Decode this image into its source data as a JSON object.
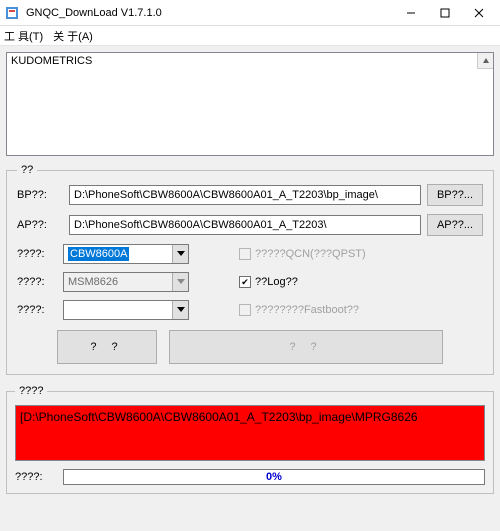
{
  "window": {
    "title": "GNQC_DownLoad V1.7.1.0"
  },
  "menu": {
    "tools": "工 具(T)",
    "about": "关 于(A)"
  },
  "log": {
    "text": "KUDOMETRICS"
  },
  "paths_group": {
    "legend": "??",
    "bp_label": "BP??:",
    "bp_value": "D:\\PhoneSoft\\CBW8600A\\CBW8600A01_A_T2203\\bp_image\\",
    "bp_btn": "BP??...",
    "ap_label": "AP??:",
    "ap_value": "D:\\PhoneSoft\\CBW8600A\\CBW8600A01_A_T2203\\",
    "ap_btn": "AP??..."
  },
  "config": {
    "row1_label": "????:",
    "row1_value": "CBW8600A",
    "row1_check": "?????QCN(???QPST)",
    "row2_label": "????:",
    "row2_value": "MSM8626",
    "row2_check": "??Log??",
    "row3_label": "????:",
    "row3_value": "",
    "row3_check": "????????Fastboot??"
  },
  "buttons": {
    "left": "?   ?",
    "right": "?      ?"
  },
  "status": {
    "legend": "????",
    "text": "[D:\\PhoneSoft\\CBW8600A\\CBW8600A01_A_T2203\\bp_image\\MPRG8626",
    "progress_label": "????:",
    "progress_pct": "0%"
  }
}
